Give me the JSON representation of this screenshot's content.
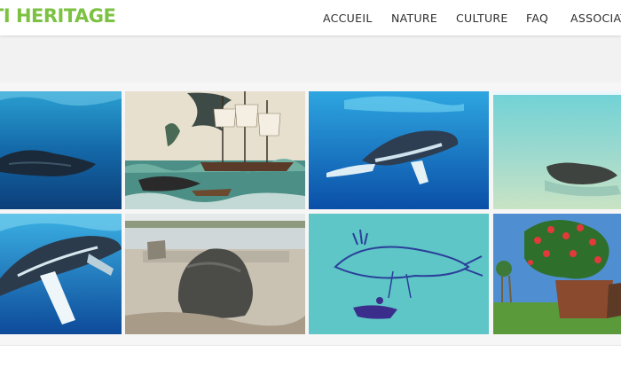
{
  "site": {
    "logo_text": "TI HERITAGE"
  },
  "nav": {
    "items": [
      {
        "label": "ACCUEIL"
      },
      {
        "label": "NATURE"
      },
      {
        "label": "CULTURE"
      },
      {
        "label": "FAQ"
      },
      {
        "label": "ASSOCIATI"
      }
    ]
  },
  "gallery": {
    "tiles": [
      {
        "subject": "whale-underwater"
      },
      {
        "subject": "whaling-ship-engraving"
      },
      {
        "subject": "humpback-whale-blue-water"
      },
      {
        "subject": "turquoise-lagoon-rock"
      },
      {
        "subject": "humpback-whale-fin"
      },
      {
        "subject": "coral-rock-beach"
      },
      {
        "subject": "child-drawing-whale"
      },
      {
        "subject": "red-flowering-tree-garden"
      }
    ]
  },
  "colors": {
    "brand_green": "#7cc242",
    "nav_text": "#2d2d2d",
    "band_grey": "#f2f2f2"
  }
}
